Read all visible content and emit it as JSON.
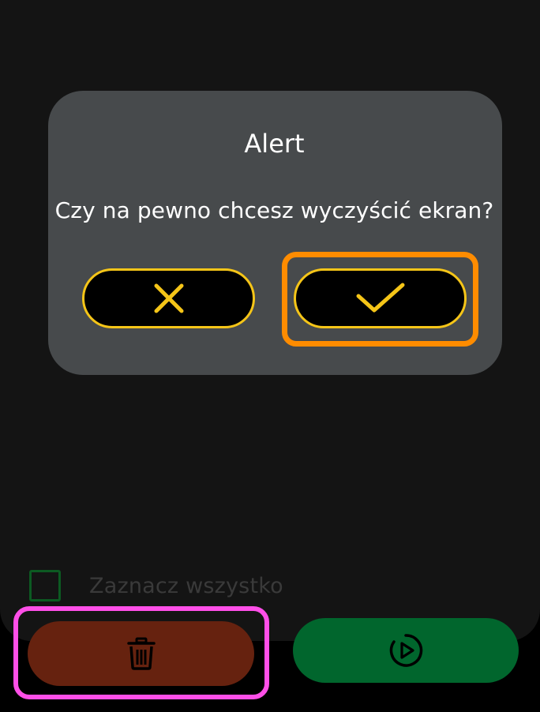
{
  "screen": {
    "select_all_label": "Zaznacz wszystko",
    "select_all_checked": false
  },
  "dialog": {
    "title": "Alert",
    "message": "Czy na pewno chcesz wyczyścić ekran?",
    "cancel_icon": "close-icon",
    "confirm_icon": "check-icon"
  },
  "bottom_bar": {
    "delete_icon": "trash-icon",
    "run_icon": "play-circle-icon"
  },
  "colors": {
    "dialog_bg": "#474a4c",
    "button_border": "#f5c518",
    "delete_button": "#66220f",
    "run_button": "#01662d",
    "checkbox_border": "#0c5a22",
    "highlight_magenta": "#ff4fe8",
    "highlight_orange": "#ff8c00"
  }
}
